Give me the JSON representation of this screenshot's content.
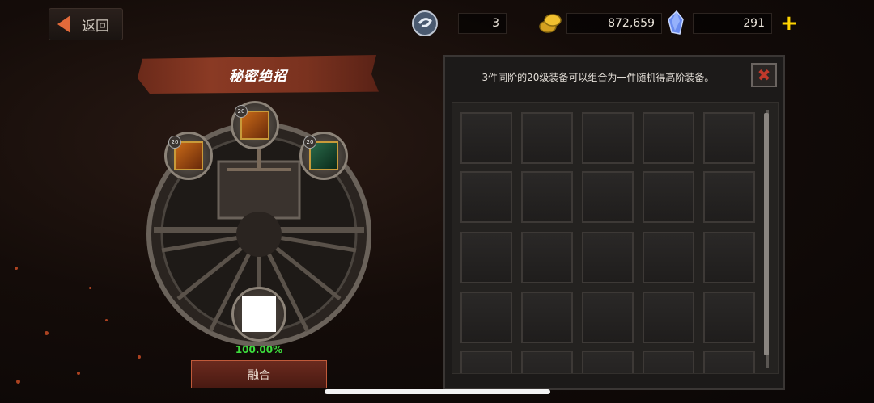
{
  "top_bar": {
    "back_label": "返回",
    "currencies": [
      {
        "icon": "swirl-token-icon",
        "value": "3"
      },
      {
        "icon": "gold-coins-icon",
        "value": "872,659",
        "plus": "+"
      },
      {
        "icon": "blue-crystal-icon",
        "value": "291",
        "plus": "+"
      }
    ]
  },
  "fusion": {
    "title": "秘密绝招",
    "slots": [
      {
        "level": "20"
      },
      {
        "level": "20"
      },
      {
        "level": "20"
      }
    ],
    "success_rate": "100.00%",
    "fuse_button": "融合"
  },
  "inventory": {
    "description": "3件同阶的20级装备可以组合为一件随机得高阶装备。",
    "close_symbol": "✖"
  },
  "colors": {
    "accent": "#e26a3a",
    "success": "#3ddc3d",
    "gold": "#ffd400"
  }
}
